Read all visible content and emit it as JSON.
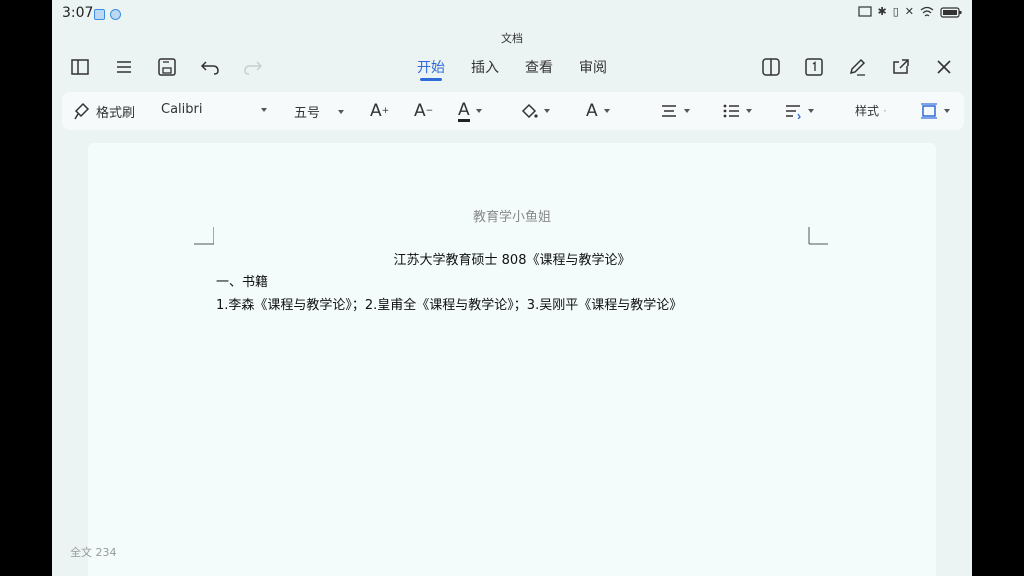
{
  "status_bar": {
    "time": "3:07"
  },
  "app": {
    "title": "文档"
  },
  "tabs": [
    {
      "label": "开始",
      "active": true
    },
    {
      "label": "插入",
      "active": false
    },
    {
      "label": "查看",
      "active": false
    },
    {
      "label": "审阅",
      "active": false
    }
  ],
  "format_toolbar": {
    "format_painter": "格式刷",
    "font_name": "Calibri",
    "font_size": "五号",
    "styles": "样式"
  },
  "document": {
    "header": "教育学小鱼姐",
    "heading": "江苏大学教育硕士 808《课程与教学论》",
    "lines": [
      "一、书籍",
      "1.李森《课程与教学论》；2.皇甫全《课程与教学论》；3.吴刚平《课程与教学论》"
    ],
    "word_count": "全文 234"
  },
  "colors": {
    "accent": "#2f6bd8",
    "background": "#ecf3f3",
    "page": "#f3fbfb"
  }
}
